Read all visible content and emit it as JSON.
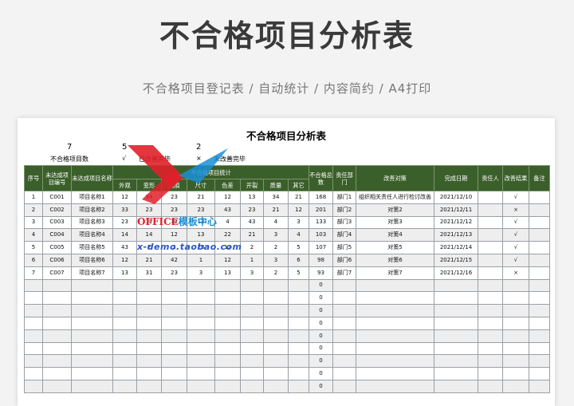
{
  "page": {
    "title": "不合格项目分析表",
    "subtitle": "不合格项目登记表 / 自动统计 / 内容简约 / A4打印"
  },
  "sheet": {
    "title": "不合格项目分析表",
    "summary": {
      "total_value": "7",
      "total_label": "不合格项目数",
      "done_value": "5",
      "done_mark": "√",
      "done_label": "已改善完毕",
      "todo_value": "2",
      "todo_mark": "×",
      "todo_label": "未改善完毕"
    },
    "headers": {
      "seq": "序号",
      "code": "未达成项目编号",
      "name": "未达成项目名称",
      "group": "不合格项目统计",
      "sub": [
        "外观",
        "变形",
        "划痕",
        "尺寸",
        "色差",
        "开裂",
        "质量",
        "其它"
      ],
      "total": "不合格总数",
      "dept": "责任部门",
      "measure": "改善对策",
      "date": "完成日期",
      "owner": "责任人",
      "result": "改善结果",
      "note": "备注"
    },
    "rows": [
      {
        "seq": "1",
        "code": "C001",
        "name": "项目名称1",
        "v": [
          "12",
          "34",
          "23",
          "21",
          "12",
          "13",
          "34",
          "21"
        ],
        "total": "168",
        "dept": "部门1",
        "measure": "组织相关责任人进行检讨改善",
        "date": "2021/12/10",
        "owner": "",
        "result": "√",
        "note": ""
      },
      {
        "seq": "2",
        "code": "C002",
        "name": "项目名称2",
        "v": [
          "33",
          "23",
          "23",
          "23",
          "43",
          "23",
          "21",
          "12"
        ],
        "total": "201",
        "dept": "部门2",
        "measure": "对策2",
        "date": "2021/12/11",
        "owner": "",
        "result": "×",
        "note": ""
      },
      {
        "seq": "3",
        "code": "C003",
        "name": "项目名称3",
        "v": [
          "23",
          "12",
          "12",
          "12",
          "4",
          "43",
          "4",
          "3"
        ],
        "total": "133",
        "dept": "部门3",
        "measure": "对策3",
        "date": "2021/12/12",
        "owner": "",
        "result": "√",
        "note": ""
      },
      {
        "seq": "4",
        "code": "C004",
        "name": "项目名称4",
        "v": [
          "14",
          "14",
          "12",
          "13",
          "22",
          "21",
          "3",
          "4"
        ],
        "total": "103",
        "dept": "部门4",
        "measure": "对策4",
        "date": "2021/12/13",
        "owner": "",
        "result": "√",
        "note": ""
      },
      {
        "seq": "5",
        "code": "C005",
        "name": "项目名称5",
        "v": [
          "43",
          "2",
          "2",
          "23",
          "12",
          "2",
          "2",
          "5"
        ],
        "total": "107",
        "dept": "部门5",
        "measure": "对策5",
        "date": "2021/12/14",
        "owner": "",
        "result": "√",
        "note": ""
      },
      {
        "seq": "6",
        "code": "C006",
        "name": "项目名称6",
        "v": [
          "12",
          "21",
          "42",
          "1",
          "12",
          "1",
          "3",
          "6"
        ],
        "total": "98",
        "dept": "部门6",
        "measure": "对策6",
        "date": "2021/12/15",
        "owner": "",
        "result": "√",
        "note": ""
      },
      {
        "seq": "7",
        "code": "C007",
        "name": "项目名称7",
        "v": [
          "13",
          "31",
          "23",
          "3",
          "13",
          "3",
          "2",
          "5"
        ],
        "total": "93",
        "dept": "部门7",
        "measure": "对策7",
        "date": "2021/12/16",
        "owner": "",
        "result": "×",
        "note": ""
      },
      {
        "seq": "",
        "code": "",
        "name": "",
        "v": [
          "",
          "",
          "",
          "",
          "",
          "",
          "",
          ""
        ],
        "total": "0",
        "dept": "",
        "measure": "",
        "date": "",
        "owner": "",
        "result": "",
        "note": ""
      },
      {
        "seq": "",
        "code": "",
        "name": "",
        "v": [
          "",
          "",
          "",
          "",
          "",
          "",
          "",
          ""
        ],
        "total": "0",
        "dept": "",
        "measure": "",
        "date": "",
        "owner": "",
        "result": "",
        "note": ""
      },
      {
        "seq": "",
        "code": "",
        "name": "",
        "v": [
          "",
          "",
          "",
          "",
          "",
          "",
          "",
          ""
        ],
        "total": "0",
        "dept": "",
        "measure": "",
        "date": "",
        "owner": "",
        "result": "",
        "note": ""
      },
      {
        "seq": "",
        "code": "",
        "name": "",
        "v": [
          "",
          "",
          "",
          "",
          "",
          "",
          "",
          ""
        ],
        "total": "0",
        "dept": "",
        "measure": "",
        "date": "",
        "owner": "",
        "result": "",
        "note": ""
      },
      {
        "seq": "",
        "code": "",
        "name": "",
        "v": [
          "",
          "",
          "",
          "",
          "",
          "",
          "",
          ""
        ],
        "total": "0",
        "dept": "",
        "measure": "",
        "date": "",
        "owner": "",
        "result": "",
        "note": ""
      },
      {
        "seq": "",
        "code": "",
        "name": "",
        "v": [
          "",
          "",
          "",
          "",
          "",
          "",
          "",
          ""
        ],
        "total": "0",
        "dept": "",
        "measure": "",
        "date": "",
        "owner": "",
        "result": "",
        "note": ""
      },
      {
        "seq": "",
        "code": "",
        "name": "",
        "v": [
          "",
          "",
          "",
          "",
          "",
          "",
          "",
          ""
        ],
        "total": "0",
        "dept": "",
        "measure": "",
        "date": "",
        "owner": "",
        "result": "",
        "note": ""
      },
      {
        "seq": "",
        "code": "",
        "name": "",
        "v": [
          "",
          "",
          "",
          "",
          "",
          "",
          "",
          ""
        ],
        "total": "0",
        "dept": "",
        "measure": "",
        "date": "",
        "owner": "",
        "result": "",
        "note": ""
      },
      {
        "seq": "",
        "code": "",
        "name": "",
        "v": [
          "",
          "",
          "",
          "",
          "",
          "",
          "",
          ""
        ],
        "total": "0",
        "dept": "",
        "measure": "",
        "date": "",
        "owner": "",
        "result": "",
        "note": ""
      }
    ]
  },
  "watermark": {
    "brand": "OFFICE模板中心",
    "url": "x-demo.taobao.com",
    "icon": "x-logo-icon"
  },
  "colors": {
    "header_bg": "#3b5f2a",
    "alt_row": "#eeeeee",
    "logo_red": "#e0202a",
    "logo_blue": "#1a8fd6"
  }
}
